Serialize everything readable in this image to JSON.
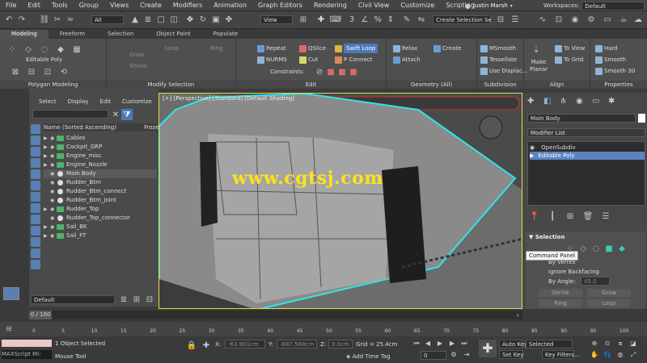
{
  "menubar": {
    "items": [
      "File",
      "Edit",
      "Tools",
      "Group",
      "Views",
      "Create",
      "Modifiers",
      "Animation",
      "Graph Editors",
      "Rendering",
      "Civil View",
      "Customize",
      "Scripting"
    ],
    "user": "Justin Marsh",
    "workspaces_label": "Workspaces:",
    "workspace": "Default"
  },
  "toolbar": {
    "filter": "All",
    "view": "View",
    "selection_set": "Create Selection Se"
  },
  "ribbon_tabs": [
    "Modeling",
    "Freeform",
    "Selection",
    "Object Paint",
    "Populate"
  ],
  "ribbon": {
    "editable_poly": "Editable Poly",
    "groups": [
      "Polygon Modeling",
      "Modify Selection",
      "Edit",
      "Geometry (All)",
      "Subdivision",
      "Align",
      "Properties"
    ],
    "modify": [
      "Grow",
      "Shrink",
      "Loop",
      "Ring"
    ],
    "edit": {
      "repeat": "Repeat",
      "qslice": "QSlice",
      "swift_loop": "Swift Loop",
      "nurms": "NURMS",
      "cut": "Cut",
      "p_connect": "P Connect",
      "constraints": "Constraints:"
    },
    "geometry": {
      "relax": "Relax",
      "create": "Create",
      "attach": "Attach"
    },
    "subdivision": {
      "msmooth": "MSmooth",
      "tessellate": "Tessellate",
      "use_displac": "Use Displac..."
    },
    "align": {
      "make_planar": "Make Planar",
      "to_view": "To View",
      "to_grid": "To Grid"
    },
    "properties": {
      "hard": "Hard",
      "smooth": "Smooth",
      "smooth30": "Smooth 30"
    }
  },
  "scene_explorer": {
    "tabs": [
      "Select",
      "Display",
      "Edit",
      "Customize"
    ],
    "header": "Name (Sorted Ascending)",
    "header2": "Froze",
    "items": [
      {
        "label": "Cables",
        "selected": false
      },
      {
        "label": "Cockpit_GRP",
        "selected": false
      },
      {
        "label": "Engine_misc",
        "selected": false
      },
      {
        "label": "Engine_Nozzle",
        "selected": false
      },
      {
        "label": "Main Body",
        "selected": true
      },
      {
        "label": "Rudder_Btm",
        "selected": false
      },
      {
        "label": "Rudder_Btm_connect",
        "selected": false
      },
      {
        "label": "Rudder_Btm_joint",
        "selected": false
      },
      {
        "label": "Rudder_Top",
        "selected": false
      },
      {
        "label": "Rudder_Top_connector",
        "selected": false
      },
      {
        "label": "Sail_BK",
        "selected": false
      },
      {
        "label": "Sail_FT",
        "selected": false
      }
    ],
    "layer": "Default"
  },
  "viewport": {
    "label": "[+] [Perspective] [Standard] [Default Shading]",
    "watermark": "www.cgtsj.com"
  },
  "command_panel": {
    "object_name": "Main Body",
    "modifier_list": "Modifier List",
    "stack": [
      {
        "label": "OpenSubdiv",
        "selected": false
      },
      {
        "label": "Editable Poly",
        "selected": true
      }
    ],
    "selection_title": "Selection",
    "tooltip": "Command Panel",
    "by_vertex": "By Vertex",
    "ignore_backfacing": "Ignore Backfacing",
    "by_angle": "By Angle:",
    "angle_value": "45.0",
    "shrink": "Shrink",
    "grow": "Grow",
    "ring": "Ring",
    "loop": "Loop"
  },
  "timeline": {
    "frame": "0 / 100",
    "ticks": [
      "0",
      "5",
      "10",
      "15",
      "20",
      "25",
      "30",
      "35",
      "40",
      "45",
      "50",
      "55",
      "60",
      "65",
      "70",
      "75",
      "80",
      "85",
      "90",
      "95",
      "100"
    ]
  },
  "status": {
    "maxscript": "MAXScript Mi:",
    "objects": "1 Object Selected",
    "mouse_tool": "Mouse Tool",
    "x_label": "X:",
    "x_value": "-63.901cm",
    "y_label": "Y:",
    "y_value": "-687.568cm",
    "z_label": "Z:",
    "z_value": "0.0cm",
    "grid": "Grid = 25.4cm",
    "add_time_tag": "Add Time Tag",
    "auto_key": "Auto Key",
    "set_key": "Set Key",
    "selected": "Selected",
    "key_filters": "Key Filters..."
  },
  "colors": {
    "accent": "#4a7ab8",
    "selection_outline": "#2ee6e6",
    "watermark": "#ffe21a",
    "viewport_border": "#e8d84a"
  }
}
